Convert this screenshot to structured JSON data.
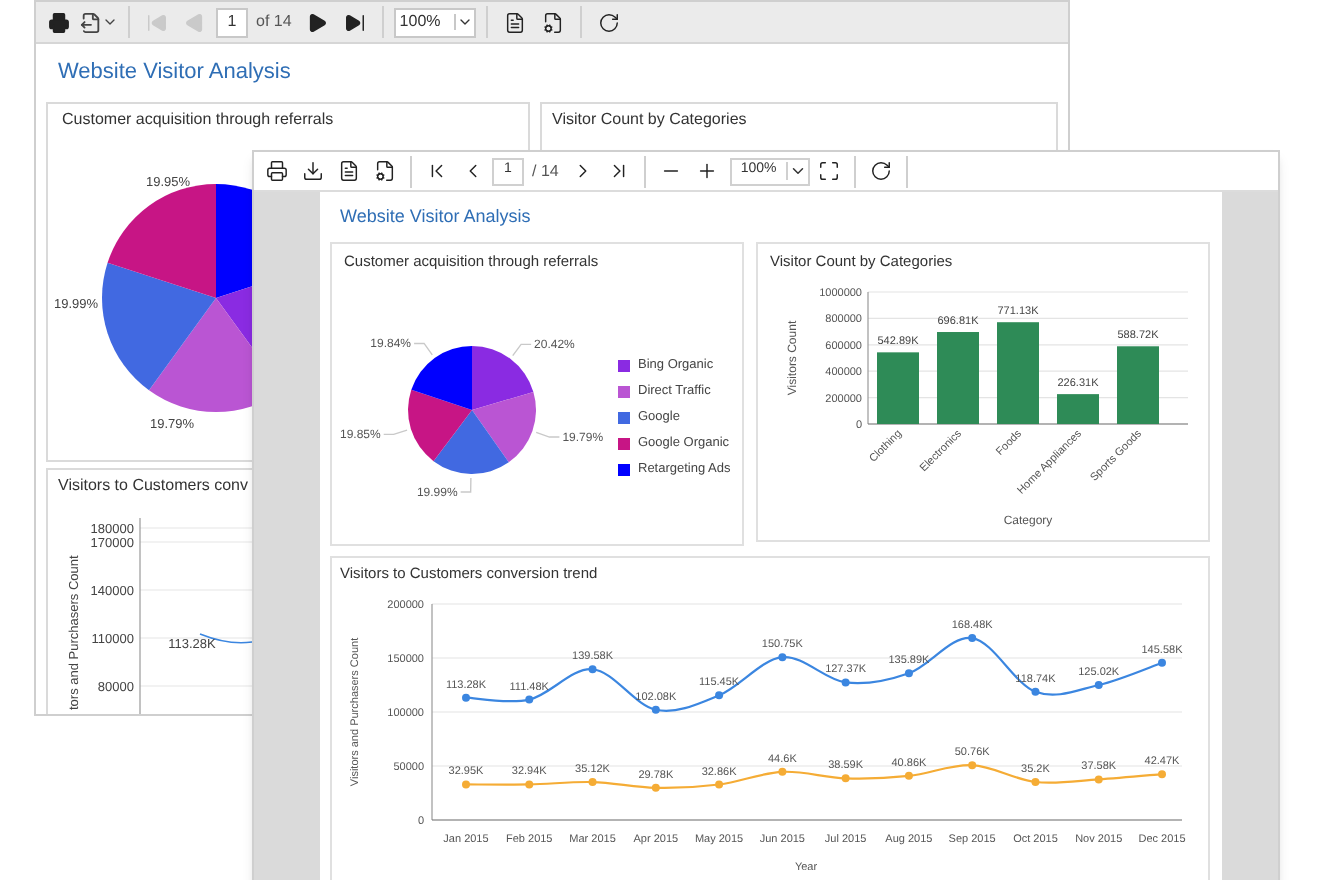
{
  "back_window": {
    "toolbar": {
      "nav_buttons": [
        {
          "kind": "first",
          "disabled": true
        },
        {
          "kind": "prev",
          "disabled": true
        },
        {
          "kind": "next",
          "disabled": false
        },
        {
          "kind": "last",
          "disabled": false
        }
      ],
      "page_field": "1",
      "page_count": "of 14",
      "zoom_field": "100%"
    },
    "title": "Website Visitor Analysis",
    "referrals_card": {
      "title": "Customer acquisition through referrals",
      "slice_labels": [
        "19.95%",
        "19.99%",
        "19.79%"
      ]
    },
    "categories_card": {
      "title": "Visitor Count by Categories"
    },
    "trend_card": {
      "title": "Visitors to Customers conv",
      "yticks": [
        "180000",
        "170000",
        "140000",
        "110000",
        "80000"
      ],
      "ylabel": "tors and Purchasers Count",
      "point_label": "113.28K"
    }
  },
  "front_window": {
    "toolbar": {
      "nav_buttons": [
        {
          "kind": "first"
        },
        {
          "kind": "prev"
        },
        {
          "kind": "next"
        },
        {
          "kind": "last"
        }
      ],
      "page_field": "1",
      "page_count": "/ 14",
      "zoom_field": "100%"
    },
    "title": "Website Visitor Analysis",
    "referrals_card": {
      "title": "Customer acquisition through referrals",
      "chart_data": {
        "type": "pie",
        "categories": [
          "Bing Organic",
          "Direct Traffic",
          "Google",
          "Google Organic",
          "Retargeting Ads"
        ],
        "values": [
          20.42,
          19.79,
          19.99,
          19.85,
          19.84
        ],
        "colors": [
          "#8a2be2",
          "#ba55d3",
          "#4169e1",
          "#c71585",
          "#0000ff"
        ],
        "legend": true,
        "value_labels": [
          "20.42%",
          "19.79%",
          "19.99%",
          "19.85%",
          "19.84%"
        ]
      }
    },
    "categories_card": {
      "title": "Visitor Count by Categories",
      "chart_data": {
        "type": "bar",
        "xlabel": "Category",
        "ylabel": "Visitors Count",
        "categories": [
          "Clothing",
          "Electronics",
          "Foods",
          "Home Appliances",
          "Sports Goods"
        ],
        "series": [
          {
            "color": "#2e8b57",
            "values": [
              542890,
              696810,
              771130,
              226310,
              588720
            ]
          }
        ],
        "ylim": [
          0,
          1000000
        ],
        "grid": true,
        "yticks": [
          0,
          200000,
          400000,
          600000,
          800000,
          1000000
        ],
        "value_labels": [
          "542.89K",
          "696.81K",
          "771.13K",
          "226.31K",
          "588.72K"
        ]
      }
    },
    "trend_card": {
      "title": "Visitors to Customers conversion trend",
      "chart_data": {
        "type": "line",
        "xlabel": "Year",
        "ylabel": "Visitors and Purchasers Count",
        "x": [
          "Jan 2015",
          "Feb 2015",
          "Mar 2015",
          "Apr 2015",
          "May 2015",
          "Jun 2015",
          "Jul 2015",
          "Aug 2015",
          "Sep 2015",
          "Oct 2015",
          "Nov 2015",
          "Dec 2015"
        ],
        "series": [
          {
            "color": "#3b86e0",
            "marker": "circle",
            "values": [
              113280,
              111480,
              139580,
              102080,
              115450,
              150750,
              127370,
              135890,
              168480,
              118740,
              125020,
              145580
            ],
            "value_labels": [
              "113.28K",
              "111.48K",
              "139.58K",
              "102.08K",
              "115.45K",
              "150.75K",
              "127.37K",
              "135.89K",
              "168.48K",
              "118.74K",
              "125.02K",
              "145.58K"
            ]
          },
          {
            "color": "#f5ac35",
            "marker": "circle",
            "values": [
              32950,
              32940,
              35120,
              29780,
              32860,
              44600,
              38590,
              40860,
              50760,
              35200,
              37580,
              42470
            ],
            "value_labels": [
              "32.95K",
              "32.94K",
              "35.12K",
              "29.78K",
              "32.86K",
              "44.6K",
              "38.59K",
              "40.86K",
              "50.76K",
              "35.2K",
              "37.58K",
              "42.47K"
            ]
          }
        ],
        "ylim": [
          0,
          200000
        ],
        "grid": true,
        "yticks": [
          0,
          50000,
          100000,
          150000,
          200000
        ]
      }
    }
  }
}
